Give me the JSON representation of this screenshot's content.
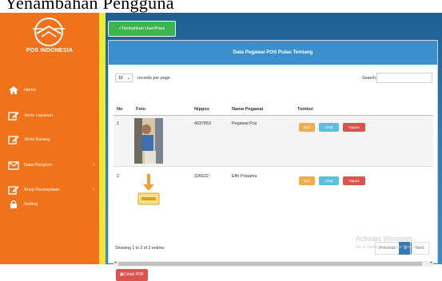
{
  "caption": {
    "text": "Yenambahan Pengguna"
  },
  "brand": {
    "name": "POS INDONESIA",
    "logo_icon": "pos-indonesia-logo",
    "color": "#f0731c"
  },
  "sidebar": {
    "items": [
      {
        "label": "Home",
        "icon": "home-icon"
      },
      {
        "label": "Jenis Layanan",
        "icon": "edit-icon"
      },
      {
        "label": "Jenis Barang",
        "icon": "edit-icon"
      },
      {
        "label": "Data Pengirim",
        "icon": "mail-icon",
        "has_chevron": true,
        "chevron": "‹"
      },
      {
        "label": "Arsip Pendapatan",
        "icon": "edit-icon",
        "has_chevron": true,
        "chevron": "‹"
      },
      {
        "label": "Setting",
        "icon": "lock-icon"
      }
    ]
  },
  "toolbar": {
    "add_label": "+Tambahkan User/Pass",
    "add_color": "#3cb54f"
  },
  "panel": {
    "title": "Data Pegawai POS Pulau Temiang"
  },
  "table_controls": {
    "length_value": "10",
    "length_caret": "⌄",
    "length_label": "records per page",
    "search_label": "Search:",
    "search_value": ""
  },
  "table": {
    "columns": [
      "No",
      "Foto",
      "Nippos",
      "Nama Pegawai",
      "Tombol"
    ],
    "rows": [
      {
        "no": "1",
        "nippos": "4037853",
        "nama": "Pegawai Pos",
        "photo_icon": "employee-photo"
      },
      {
        "no": "2",
        "nippos": "326622",
        "nama": "Effri Pratama",
        "photo_icon": "document-download-icon"
      }
    ],
    "actions": {
      "edit": "Edit",
      "view": "Lihat",
      "delete": "Hapus"
    }
  },
  "footer": {
    "info": "Showing 1 to 2 of 2 entries",
    "previous": "Previous",
    "page": "1",
    "next": "Next",
    "scroll_left": "◂",
    "scroll_right": "▸"
  },
  "pdf_button": {
    "label": "Cetak PDF",
    "color": "#d9534f"
  },
  "watermark": {
    "title": "Activate Windows",
    "subtitle": "Go to Settings to activate Windows."
  }
}
